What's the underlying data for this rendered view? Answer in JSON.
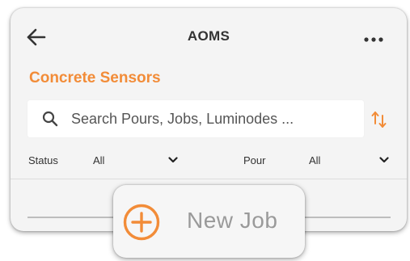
{
  "header": {
    "title": "AOMS",
    "back_icon": "arrow-left-icon",
    "more_icon": "more-horizontal-icon"
  },
  "section": {
    "title": "Concrete Sensors"
  },
  "search": {
    "placeholder": "Search Pours, Jobs, Luminodes ...",
    "value": "",
    "icon": "search-icon",
    "sort_icon": "sort-icon"
  },
  "filters": {
    "status": {
      "label": "Status",
      "value": "All"
    },
    "pour": {
      "label": "Pour",
      "value": "All"
    }
  },
  "fab": {
    "label": "New Job",
    "icon": "plus-circle-icon"
  },
  "colors": {
    "accent": "#f28c38",
    "background": "#f4f4f4",
    "text": "#333333",
    "fab_text": "#9a9a9a"
  }
}
